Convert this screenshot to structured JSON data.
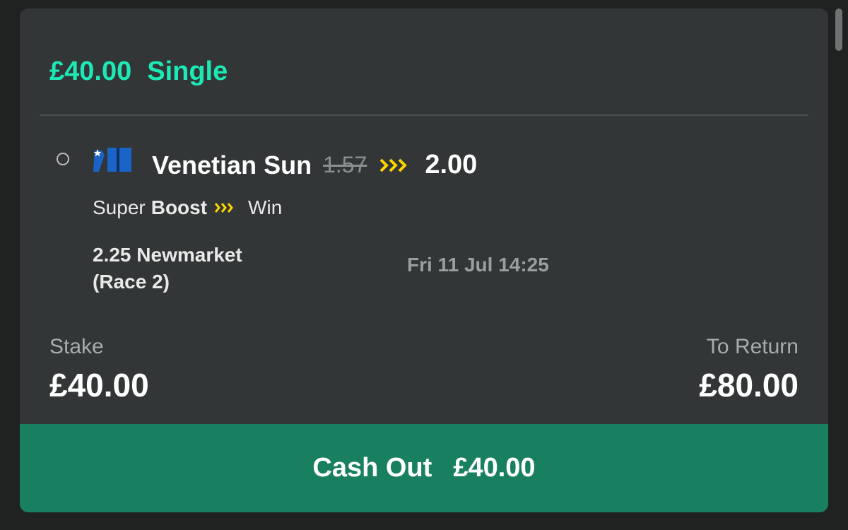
{
  "bet": {
    "amount": "£40.00",
    "type": "Single"
  },
  "selection": {
    "runner": "Venetian Sun",
    "old_odds": "1.57",
    "new_odds": "2.00",
    "boost_prefix": "Super",
    "boost_label": "Boost",
    "market": "Win",
    "event_line1": "2.25 Newmarket",
    "event_line2": "(Race 2)",
    "datetime": "Fri 11 Jul 14:25"
  },
  "stake": {
    "label": "Stake",
    "value": "£40.00"
  },
  "to_return": {
    "label": "To Return",
    "value": "£80.00"
  },
  "cash_out": {
    "label": "Cash Out",
    "value": "£40.00"
  },
  "colors": {
    "accent_green": "#1de9b6",
    "boost_yellow": "#ffd500",
    "cashout_bg": "#188060",
    "card_bg": "#323636"
  },
  "icons": {
    "silks": "jockey-silks-icon",
    "boost": "boost-chevrons-icon",
    "radio": "radio-icon"
  }
}
